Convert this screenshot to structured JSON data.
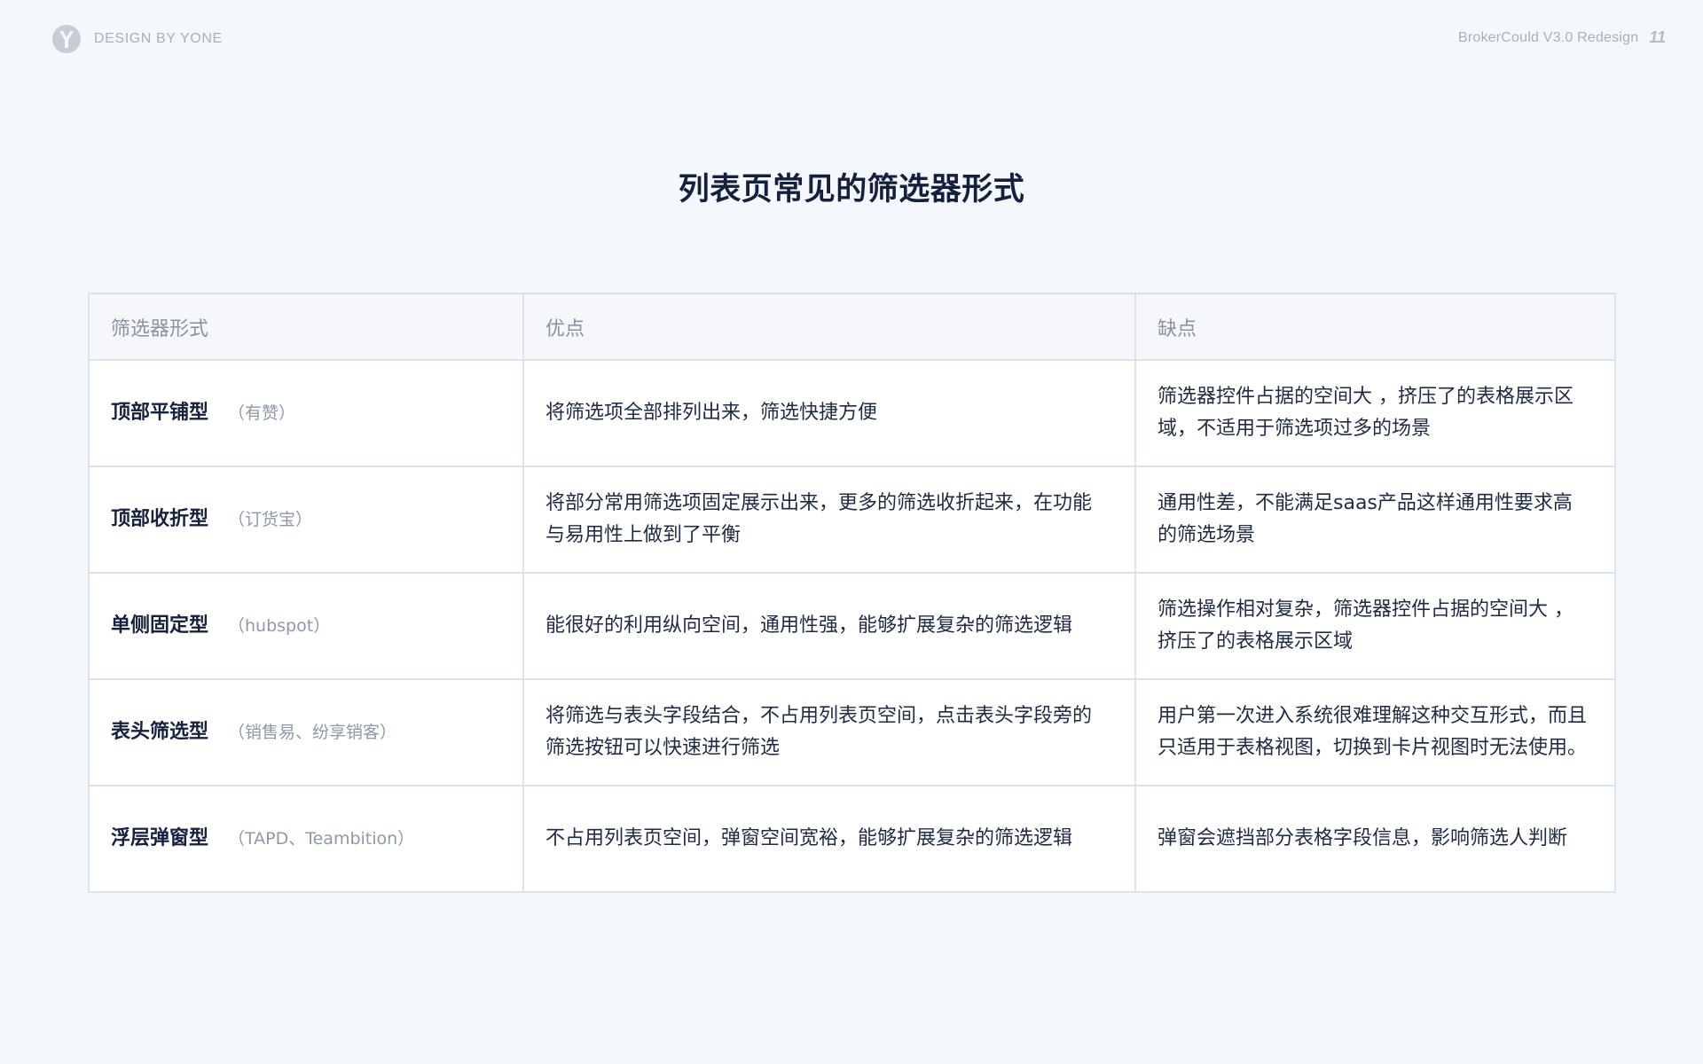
{
  "header": {
    "brand": "DESIGN BY YONE",
    "logo_icon": "y-logo-icon",
    "project": "BrokerCould V3.0 Redesign",
    "page_number": "11"
  },
  "title": "列表页常见的筛选器形式",
  "table": {
    "columns": [
      "筛选器形式",
      "优点",
      "缺点"
    ],
    "rows": [
      {
        "name": "顶部平铺型",
        "example": "（有赞）",
        "pros": "将筛选项全部排列出来，筛选快捷方便",
        "cons": "筛选器控件占据的空间大 ，挤压了的表格展示区域，不适用于筛选项过多的场景"
      },
      {
        "name": "顶部收折型",
        "example": "（订货宝）",
        "pros": "将部分常用筛选项固定展示出来，更多的筛选收折起来，在功能与易用性上做到了平衡",
        "cons": "通用性差，不能满足saas产品这样通用性要求高的筛选场景"
      },
      {
        "name": "单侧固定型",
        "example": "（hubspot）",
        "pros": "能很好的利用纵向空间，通用性强，能够扩展复杂的筛选逻辑",
        "cons": "筛选操作相对复杂，筛选器控件占据的空间大 ，挤压了的表格展示区域"
      },
      {
        "name": "表头筛选型",
        "example": "（销售易、纷享销客）",
        "pros": "将筛选与表头字段结合，不占用列表页空间，点击表头字段旁的筛选按钮可以快速进行筛选",
        "cons": "用户第一次进入系统很难理解这种交互形式，而且只适用于表格视图，切换到卡片视图时无法使用。"
      },
      {
        "name": "浮层弹窗型",
        "example": "（TAPD、Teambition）",
        "pros": "不占用列表页空间，弹窗空间宽裕，能够扩展复杂的筛选逻辑",
        "cons": "弹窗会遮挡部分表格字段信息，影响筛选人判断"
      }
    ]
  }
}
